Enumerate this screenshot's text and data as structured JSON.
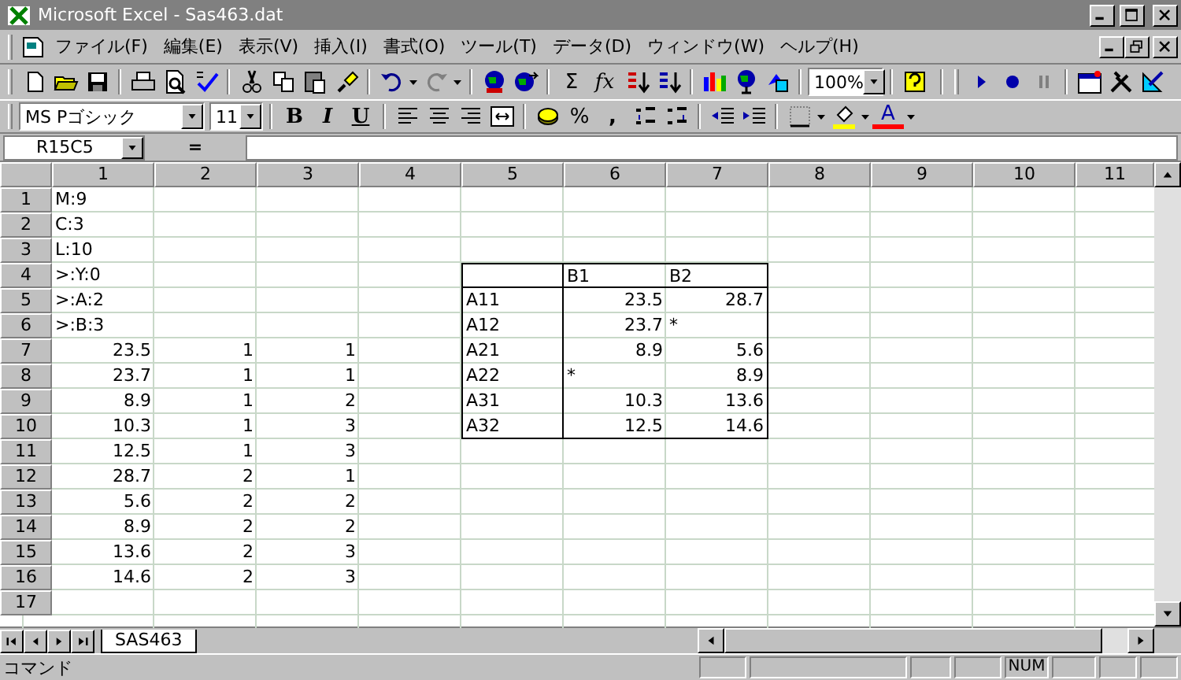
{
  "window": {
    "title": "Microsoft Excel - Sas463.dat"
  },
  "menu": [
    "ファイル(F)",
    "編集(E)",
    "表示(V)",
    "挿入(I)",
    "書式(O)",
    "ツール(T)",
    "データ(D)",
    "ウィンドウ(W)",
    "ヘルプ(H)"
  ],
  "standard_toolbar": {
    "autosum": "Σ",
    "function": "fx",
    "zoom": "100%"
  },
  "format_toolbar": {
    "font": "MS Pゴシック",
    "size": "11",
    "bold": "B",
    "italic": "I",
    "underline": "U",
    "percent": "%",
    "comma": ",",
    "font_color": "A"
  },
  "formula_bar": {
    "name_box": "R15C5",
    "equals": "="
  },
  "columns": [
    "1",
    "2",
    "3",
    "4",
    "5",
    "6",
    "7",
    "8",
    "9",
    "10",
    "11"
  ],
  "rows": [
    {
      "header": "1",
      "cells": [
        {
          "text": "M:9",
          "kind": "label"
        }
      ]
    },
    {
      "header": "2",
      "cells": [
        {
          "text": "C:3",
          "kind": "label"
        }
      ]
    },
    {
      "header": "3",
      "cells": [
        {
          "text": "L:10",
          "kind": "label"
        }
      ]
    },
    {
      "header": "4",
      "cells": [
        {
          "text": ">:Y:0",
          "kind": "label"
        },
        {},
        {},
        {},
        {
          "top_border": true,
          "left_border": true,
          "bottom_border": true,
          "right_border": true
        },
        {
          "text": "B1",
          "kind": "label",
          "top_border": true,
          "bottom_border": true
        },
        {
          "text": "B2",
          "kind": "label",
          "top_border": true,
          "bottom_border": true,
          "right_border": true
        }
      ]
    },
    {
      "header": "5",
      "cells": [
        {
          "text": ">:A:2",
          "kind": "label"
        },
        {},
        {},
        {},
        {
          "text": "A11",
          "kind": "label",
          "left_border": true,
          "right_border": true
        },
        {
          "text": "23.5",
          "kind": "number"
        },
        {
          "text": "28.7",
          "kind": "number",
          "right_border": true
        }
      ]
    },
    {
      "header": "6",
      "cells": [
        {
          "text": ">:B:3",
          "kind": "label"
        },
        {},
        {},
        {},
        {
          "text": "A12",
          "kind": "label",
          "left_border": true,
          "right_border": true
        },
        {
          "text": "23.7",
          "kind": "number"
        },
        {
          "text": "*",
          "kind": "label",
          "right_border": true
        }
      ]
    },
    {
      "header": "7",
      "cells": [
        {
          "text": "23.5",
          "kind": "number"
        },
        {
          "text": "1",
          "kind": "number"
        },
        {
          "text": "1",
          "kind": "number"
        },
        {},
        {
          "text": "A21",
          "kind": "label",
          "left_border": true,
          "right_border": true
        },
        {
          "text": "8.9",
          "kind": "number"
        },
        {
          "text": "5.6",
          "kind": "number",
          "right_border": true
        }
      ]
    },
    {
      "header": "8",
      "cells": [
        {
          "text": "23.7",
          "kind": "number"
        },
        {
          "text": "1",
          "kind": "number"
        },
        {
          "text": "1",
          "kind": "number"
        },
        {},
        {
          "text": "A22",
          "kind": "label",
          "left_border": true,
          "right_border": true
        },
        {
          "text": "*",
          "kind": "label"
        },
        {
          "text": "8.9",
          "kind": "number",
          "right_border": true
        }
      ]
    },
    {
      "header": "9",
      "cells": [
        {
          "text": "8.9",
          "kind": "number"
        },
        {
          "text": "1",
          "kind": "number"
        },
        {
          "text": "2",
          "kind": "number"
        },
        {},
        {
          "text": "A31",
          "kind": "label",
          "left_border": true,
          "right_border": true
        },
        {
          "text": "10.3",
          "kind": "number"
        },
        {
          "text": "13.6",
          "kind": "number",
          "right_border": true
        }
      ]
    },
    {
      "header": "10",
      "cells": [
        {
          "text": "10.3",
          "kind": "number"
        },
        {
          "text": "1",
          "kind": "number"
        },
        {
          "text": "3",
          "kind": "number"
        },
        {},
        {
          "text": "A32",
          "kind": "label",
          "left_border": true,
          "right_border": true,
          "bottom_border": true
        },
        {
          "text": "12.5",
          "kind": "number",
          "bottom_border": true
        },
        {
          "text": "14.6",
          "kind": "number",
          "right_border": true,
          "bottom_border": true
        }
      ]
    },
    {
      "header": "11",
      "cells": [
        {
          "text": "12.5",
          "kind": "number"
        },
        {
          "text": "1",
          "kind": "number"
        },
        {
          "text": "3",
          "kind": "number"
        }
      ]
    },
    {
      "header": "12",
      "cells": [
        {
          "text": "28.7",
          "kind": "number"
        },
        {
          "text": "2",
          "kind": "number"
        },
        {
          "text": "1",
          "kind": "number"
        }
      ]
    },
    {
      "header": "13",
      "cells": [
        {
          "text": "5.6",
          "kind": "number"
        },
        {
          "text": "2",
          "kind": "number"
        },
        {
          "text": "2",
          "kind": "number"
        }
      ]
    },
    {
      "header": "14",
      "cells": [
        {
          "text": "8.9",
          "kind": "number"
        },
        {
          "text": "2",
          "kind": "number"
        },
        {
          "text": "2",
          "kind": "number"
        }
      ]
    },
    {
      "header": "15",
      "cells": [
        {
          "text": "13.6",
          "kind": "number"
        },
        {
          "text": "2",
          "kind": "number"
        },
        {
          "text": "3",
          "kind": "number"
        }
      ]
    },
    {
      "header": "16",
      "cells": [
        {
          "text": "14.6",
          "kind": "number"
        },
        {
          "text": "2",
          "kind": "number"
        },
        {
          "text": "3",
          "kind": "number"
        }
      ]
    },
    {
      "header": "17"
    }
  ],
  "sheet_tabs": [
    {
      "label": "SAS463",
      "selected": true
    }
  ],
  "status_bar": {
    "mode": "コマンド",
    "indicators": [
      "NUM"
    ]
  }
}
